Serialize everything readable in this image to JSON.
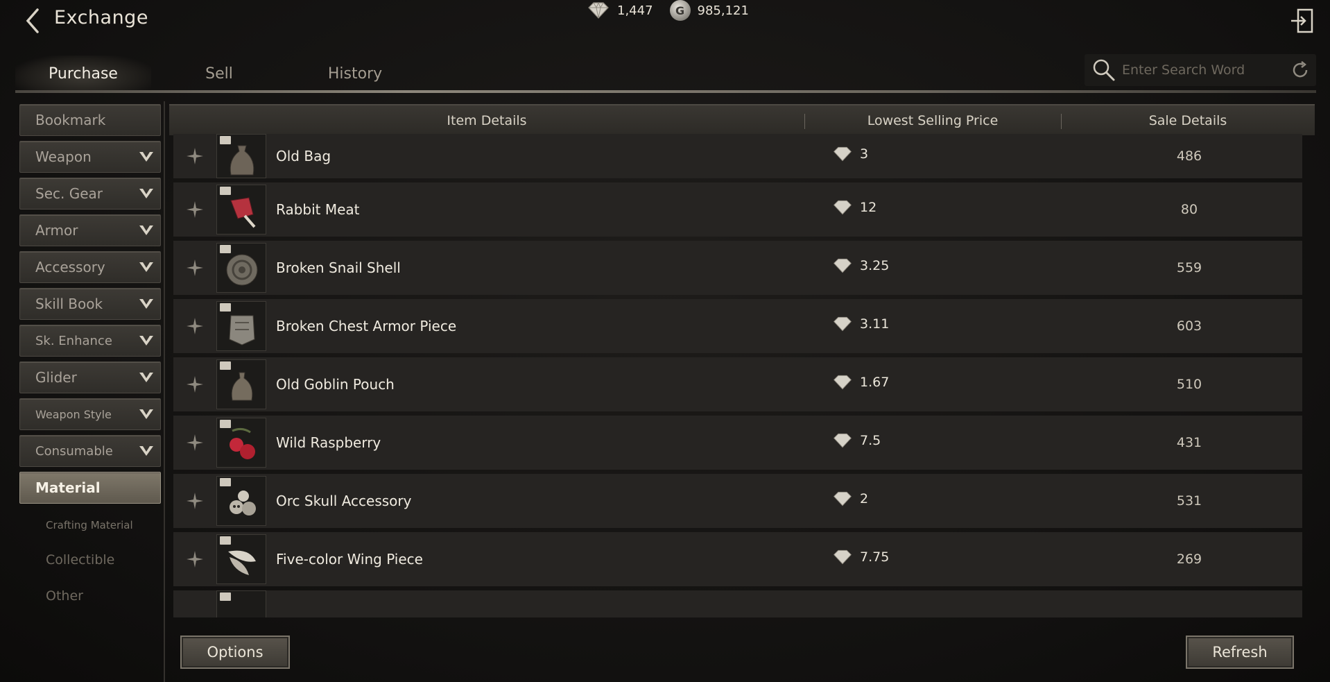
{
  "header": {
    "title": "Exchange",
    "gems": "1,447",
    "coins": "985,121",
    "coin_symbol": "G"
  },
  "tabs": [
    {
      "label": "Purchase",
      "active": true
    },
    {
      "label": "Sell",
      "active": false
    },
    {
      "label": "History",
      "active": false
    }
  ],
  "search": {
    "placeholder": "Enter Search Word",
    "value": ""
  },
  "sidebar": {
    "categories": [
      {
        "label": "Bookmark",
        "expandable": false
      },
      {
        "label": "Weapon",
        "expandable": true
      },
      {
        "label": "Sec. Gear",
        "expandable": true
      },
      {
        "label": "Armor",
        "expandable": true
      },
      {
        "label": "Accessory",
        "expandable": true
      },
      {
        "label": "Skill Book",
        "expandable": true
      },
      {
        "label": "Sk. Enhance",
        "expandable": true
      },
      {
        "label": "Glider",
        "expandable": true
      },
      {
        "label": "Weapon Style",
        "expandable": true
      },
      {
        "label": "Consumable",
        "expandable": true
      },
      {
        "label": "Material",
        "expandable": false,
        "active": true
      }
    ],
    "subcategories": [
      "Crafting Material",
      "Collectible",
      "Other"
    ]
  },
  "table": {
    "headers": [
      "Item Details",
      "Lowest Selling Price",
      "Sale Details"
    ],
    "rows": [
      {
        "name": "Old Bag",
        "price": "3",
        "sale": "486",
        "icon": "bag-icon"
      },
      {
        "name": "Rabbit Meat",
        "price": "12",
        "sale": "80",
        "icon": "meat-icon"
      },
      {
        "name": "Broken Snail Shell",
        "price": "3.25",
        "sale": "559",
        "icon": "shell-icon"
      },
      {
        "name": "Broken Chest Armor Piece",
        "price": "3.11",
        "sale": "603",
        "icon": "armor-piece-icon"
      },
      {
        "name": "Old Goblin Pouch",
        "price": "1.67",
        "sale": "510",
        "icon": "pouch-icon"
      },
      {
        "name": "Wild Raspberry",
        "price": "7.5",
        "sale": "431",
        "icon": "raspberry-icon"
      },
      {
        "name": "Orc Skull Accessory",
        "price": "2",
        "sale": "531",
        "icon": "skull-icon"
      },
      {
        "name": "Five-color Wing Piece",
        "price": "7.75",
        "sale": "269",
        "icon": "wing-icon"
      }
    ]
  },
  "footer": {
    "options_label": "Options",
    "refresh_label": "Refresh"
  },
  "colors": {
    "background": "#141312",
    "active_category": "#7f786a",
    "row": "#262422",
    "raspberry": "#c3283a"
  }
}
